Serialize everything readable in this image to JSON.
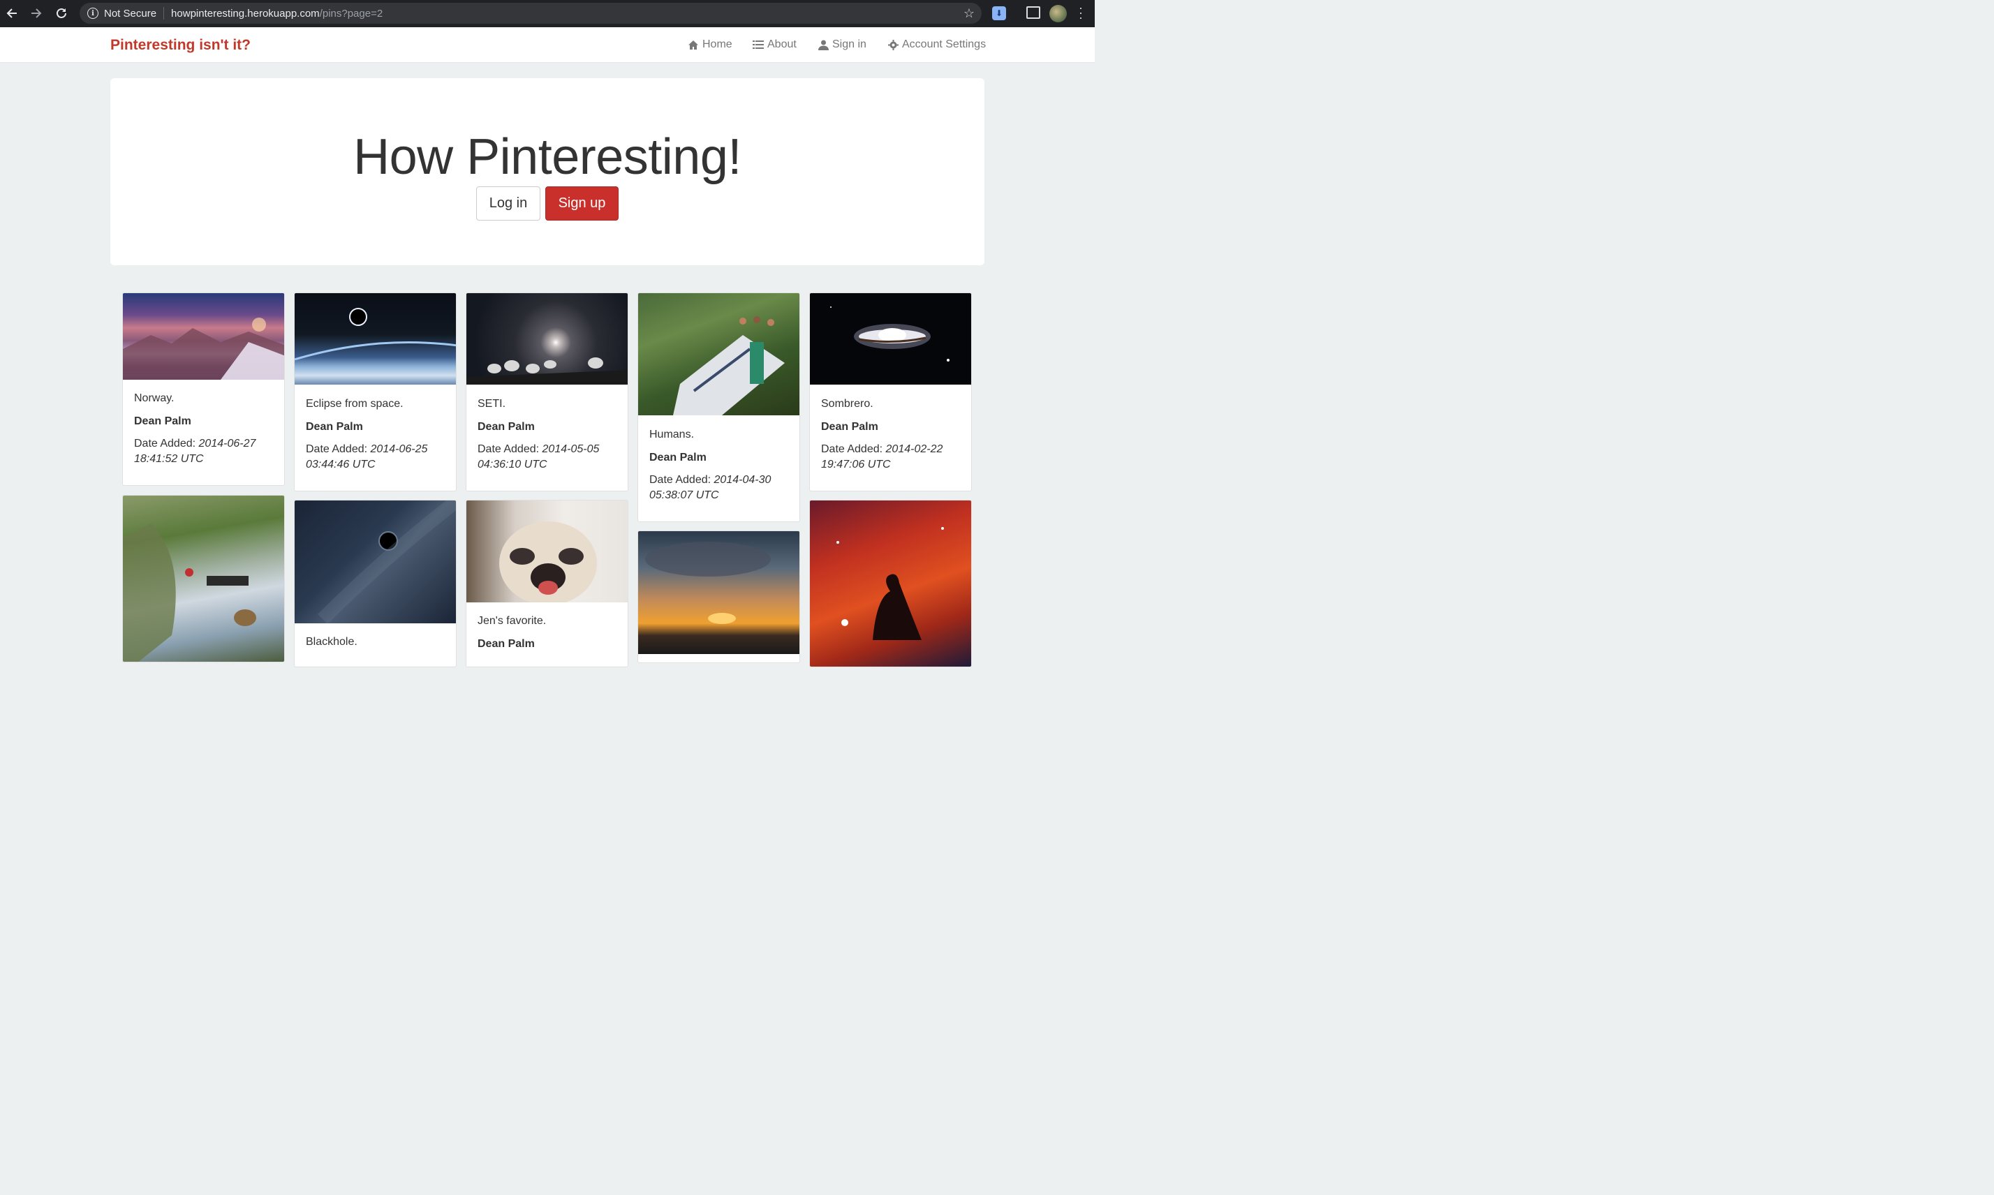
{
  "browser": {
    "security_label": "Not Secure",
    "url_host": "howpinteresting.herokuapp.com",
    "url_path": "/pins?page=2"
  },
  "navbar": {
    "brand": "Pinteresting isn't it?",
    "items": [
      {
        "label": "Home",
        "icon": "home-icon"
      },
      {
        "label": "About",
        "icon": "list-icon"
      },
      {
        "label": "Sign in",
        "icon": "user-icon"
      },
      {
        "label": "Account Settings",
        "icon": "gear-icon"
      }
    ]
  },
  "jumbotron": {
    "title": "How Pinteresting!",
    "login_label": "Log in",
    "signup_label": "Sign up"
  },
  "pins": [
    {
      "description": "Norway.",
      "user": "Dean Palm",
      "date_label": "Date Added:",
      "date": "2014-06-27 18:41:52 UTC"
    },
    {
      "description": "Eclipse from space.",
      "user": "Dean Palm",
      "date_label": "Date Added:",
      "date": "2014-06-25 03:44:46 UTC"
    },
    {
      "description": "SETI.",
      "user": "Dean Palm",
      "date_label": "Date Added:",
      "date": "2014-05-05 04:36:10 UTC"
    },
    {
      "description": "Humans.",
      "user": "Dean Palm",
      "date_label": "Date Added:",
      "date": "2014-04-30 05:38:07 UTC"
    },
    {
      "description": "Sombrero.",
      "user": "Dean Palm",
      "date_label": "Date Added:",
      "date": "2014-02-22 19:47:06 UTC"
    },
    {
      "description": "",
      "user": "",
      "date_label": "",
      "date": ""
    },
    {
      "description": "Blackhole.",
      "user": "",
      "date_label": "",
      "date": ""
    },
    {
      "description": "Jen's favorite.",
      "user": "Dean Palm",
      "date_label": "",
      "date": ""
    },
    {
      "description": "",
      "user": "",
      "date_label": "",
      "date": ""
    },
    {
      "description": "",
      "user": "",
      "date_label": "",
      "date": ""
    }
  ]
}
